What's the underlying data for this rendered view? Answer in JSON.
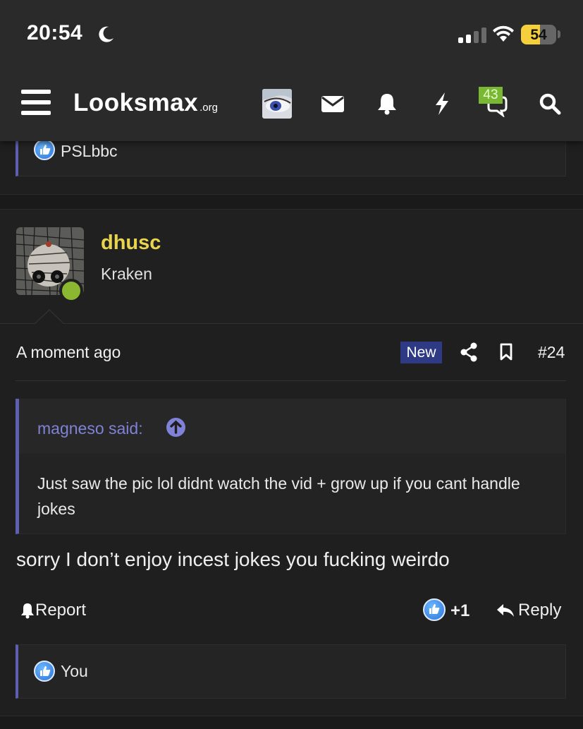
{
  "status_bar": {
    "time": "20:54",
    "battery": "54",
    "battery_level": 0.54,
    "moon_icon": "moon-icon",
    "signal_icon": "cellular-signal-icon",
    "wifi_icon": "wifi-icon"
  },
  "nav": {
    "menu_icon": "hamburger-menu-icon",
    "logo_main": "Looksmax",
    "logo_tld": ".org",
    "icons": [
      "avatar",
      "envelope-icon",
      "bell-icon",
      "bolt-icon",
      "chat-bubbles-icon",
      "search-icon"
    ],
    "conversations_badge": "43"
  },
  "previous_post": {
    "reaction_user": "PSLbbc"
  },
  "post": {
    "username": "dhusc",
    "user_title": "Kraken",
    "timestamp": "A moment ago",
    "new_label": "New",
    "post_number": "#24",
    "quote": {
      "author": "magneso said:",
      "text": "Just saw the pic lol didnt watch the vid + grow up if you cant handle jokes"
    },
    "message": "sorry I don’t enjoy incest jokes you fucking weirdo",
    "actions": {
      "report_label": "Report",
      "like_count": "+1",
      "reply_label": "Reply"
    },
    "reactions": {
      "user": "You"
    }
  },
  "colors": {
    "accent": "#5d5fb0",
    "username": "#e8d44d",
    "online": "#8cb730",
    "badge": "#7ab833",
    "new_badge": "#2e3b84",
    "battery": "#f5d03b"
  }
}
